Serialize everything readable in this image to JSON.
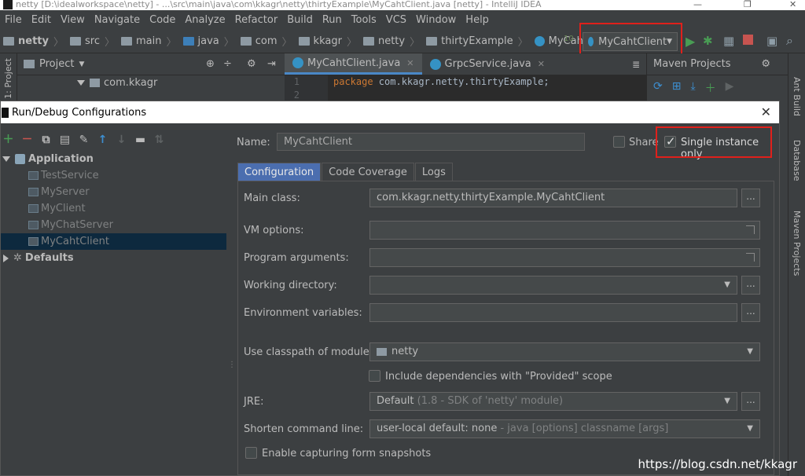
{
  "window": {
    "title": "netty [D:\\idealworkspace\\netty] - ...\\src\\main\\java\\com\\kkagr\\netty\\thirtyExample\\MyCahtClient.java [netty] - IntelliJ IDEA"
  },
  "menu": [
    "File",
    "Edit",
    "View",
    "Navigate",
    "Code",
    "Analyze",
    "Refactor",
    "Build",
    "Run",
    "Tools",
    "VCS",
    "Window",
    "Help"
  ],
  "breadcrumbs": [
    "netty",
    "src",
    "main",
    "java",
    "com",
    "kkagr",
    "netty",
    "thirtyExample",
    "MyCahtClient"
  ],
  "run_config": "MyCahtClient",
  "project_panel": {
    "side_label": "1: Project",
    "title": "Project",
    "tree_item": "com.kkagr"
  },
  "editor": {
    "tabs": [
      "MyCahtClient.java",
      "GrpcService.java"
    ],
    "line_numbers": [
      "1",
      "2"
    ],
    "code_keyword": "package",
    "code_rest": " com.kkagr.netty.thirtyExample;"
  },
  "maven_panel": {
    "title": "Maven Projects"
  },
  "right_tools": [
    "Ant Build",
    "Database",
    "Maven Projects"
  ],
  "dialog": {
    "title": "Run/Debug Configurations",
    "tree": {
      "application": "Application",
      "configs": [
        "TestService",
        "MyServer",
        "MyClient",
        "MyChatServer",
        "MyCahtClient"
      ],
      "selected": "MyCahtClient",
      "defaults": "Defaults"
    },
    "name_label": "Name:",
    "name_value": "MyCahtClient",
    "share_label": "Share",
    "single_instance_label": "Single instance only",
    "single_instance_checked": true,
    "tabs": [
      "Configuration",
      "Code Coverage",
      "Logs"
    ],
    "form": {
      "main_class_label": "Main class:",
      "main_class_value": "com.kkagr.netty.thirtyExample.MyCahtClient",
      "vm_options_label": "VM options:",
      "program_args_label": "Program arguments:",
      "working_dir_label": "Working directory:",
      "env_vars_label": "Environment variables:",
      "classpath_label": "Use classpath of module:",
      "classpath_value": "netty",
      "include_deps_label": "Include dependencies with \"Provided\" scope",
      "jre_label": "JRE:",
      "jre_value": "Default",
      "jre_hint": "(1.8 - SDK of 'netty' module)",
      "shorten_label": "Shorten command line:",
      "shorten_value": "user-local default: none",
      "shorten_hint": "- java [options] classname [args]",
      "capture_label": "Enable capturing form snapshots",
      "dots": "..."
    }
  },
  "watermark": "https://blog.csdn.net/kkagr",
  "colors": {
    "highlight": "#e0201b",
    "accent": "#4b6eaf"
  }
}
